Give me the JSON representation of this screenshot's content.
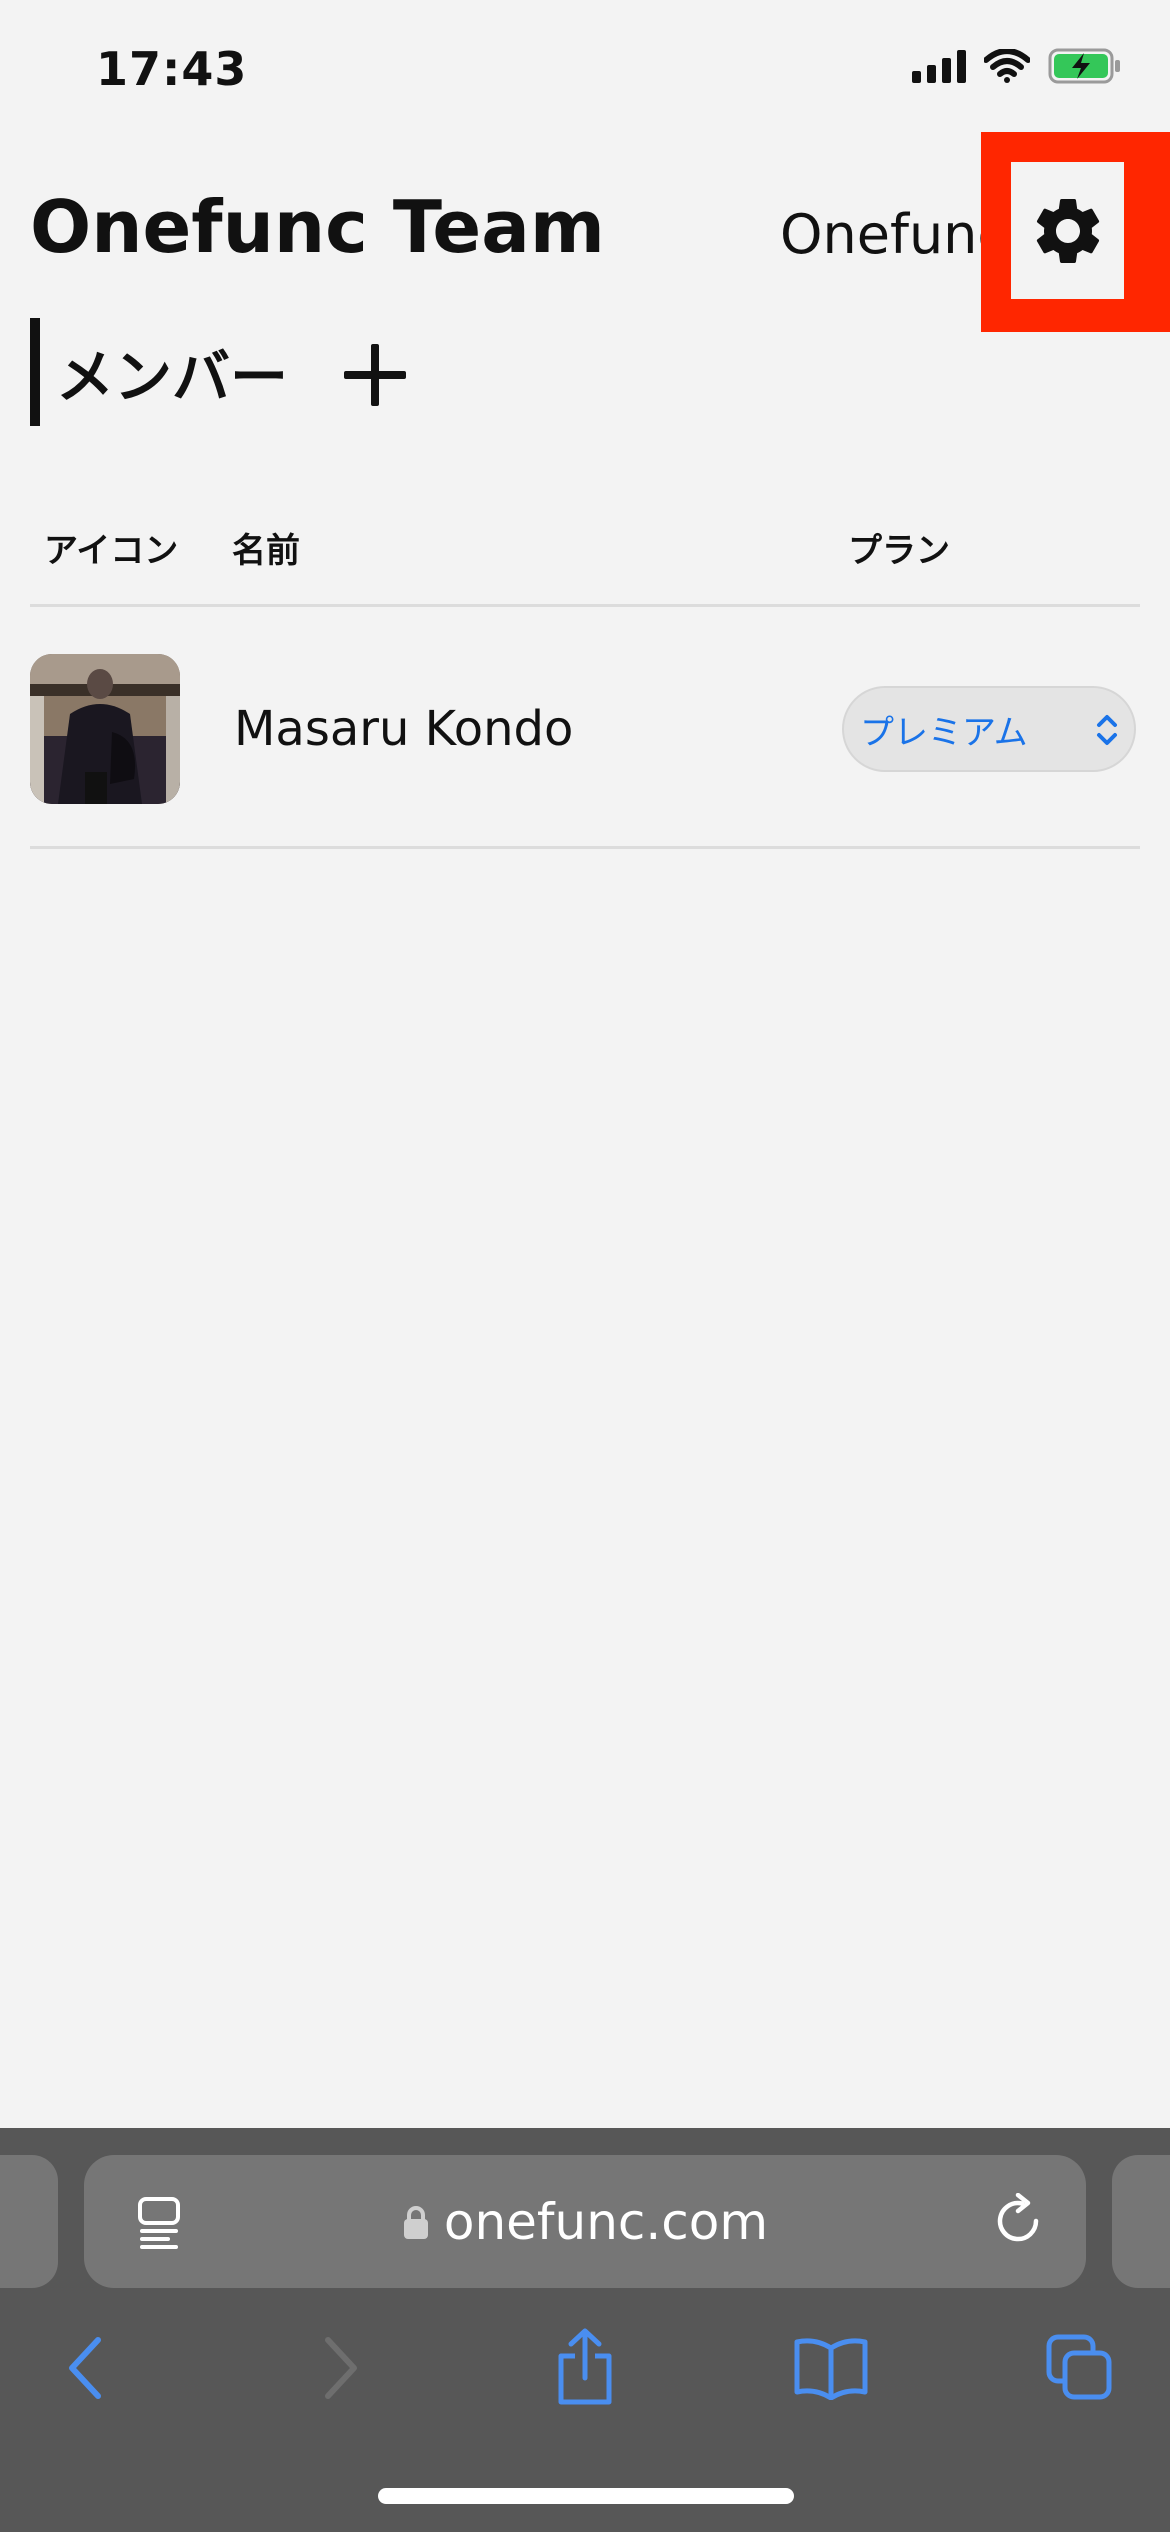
{
  "status_bar": {
    "time": "17:43"
  },
  "header": {
    "team_title": "Onefunc Team",
    "right_label": "Onefunc",
    "settings_icon": "gear-icon"
  },
  "section": {
    "title": "メンバー",
    "add_icon": "plus-icon"
  },
  "table": {
    "columns": [
      "アイコン",
      "名前",
      "プラン"
    ],
    "rows": [
      {
        "name": "Masaru Kondo",
        "plan": "プレミアム"
      }
    ]
  },
  "browser": {
    "url": "onefunc.com",
    "icons": [
      "reader-icon",
      "lock-icon",
      "reload-icon",
      "back-icon",
      "forward-icon",
      "share-icon",
      "bookmarks-icon",
      "tabs-icon"
    ]
  },
  "colors": {
    "accent_blue": "#1a73e8",
    "highlight_red": "#ff2600",
    "battery_green": "#34c759"
  }
}
